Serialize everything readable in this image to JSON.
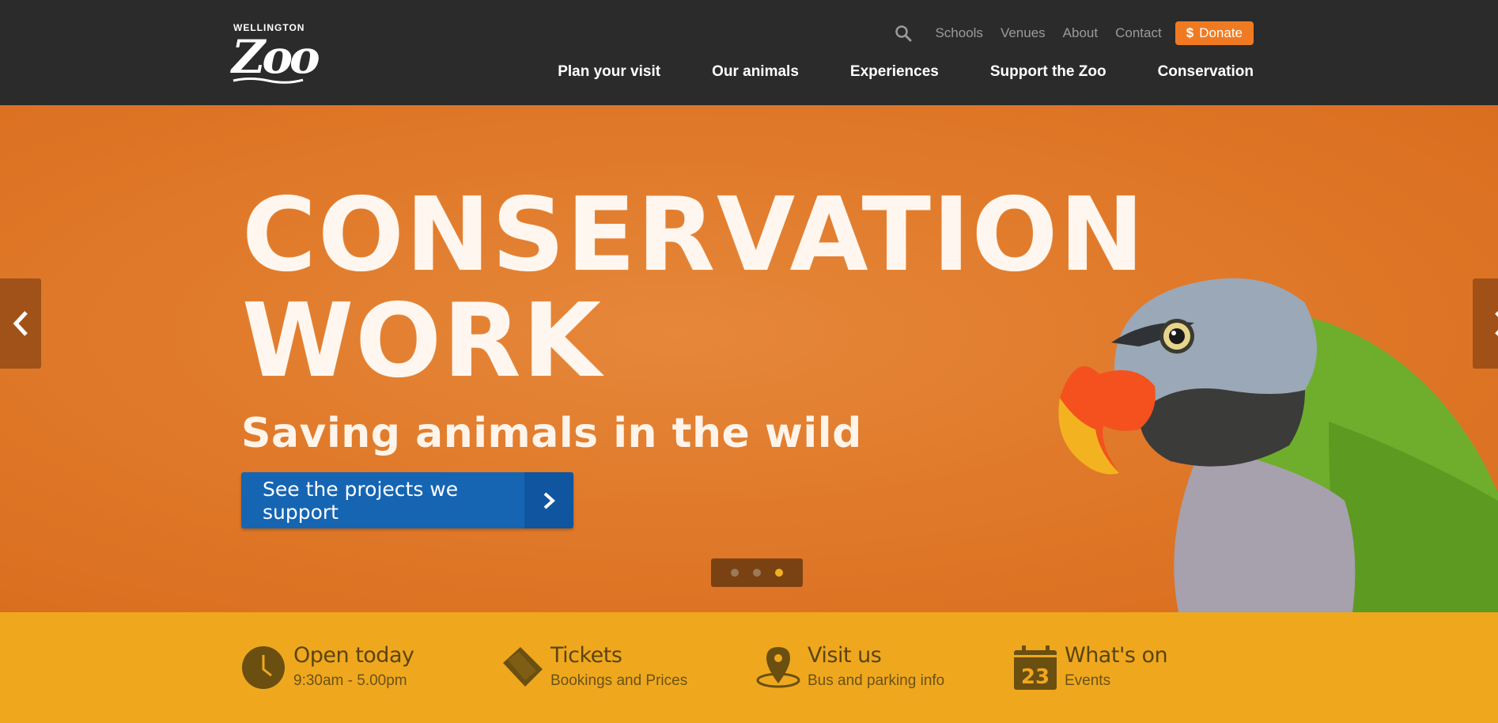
{
  "header": {
    "logo": {
      "top_text": "WELLINGTON",
      "main_text": "Zoo"
    },
    "utility_links": [
      "Schools",
      "Venues",
      "About",
      "Contact"
    ],
    "donate": {
      "label": "Donate",
      "icon": "dollar-icon",
      "color": "#f07a22"
    },
    "search_icon": "search-icon",
    "nav": [
      "Plan your visit",
      "Our animals",
      "Experiences",
      "Support the Zoo",
      "Conservation"
    ],
    "background": "#2b2b2b"
  },
  "hero": {
    "title_line1": "CONSERVATION",
    "title_line2": "WORK",
    "subtitle": "Saving animals in the wild",
    "cta_label": "See the projects we support",
    "background": "#e07a2a",
    "slides_count": 3,
    "active_slide": 3
  },
  "infobar": {
    "background": "#efa81e",
    "items": [
      {
        "title": "Open today",
        "sub": "9:30am - 5.00pm",
        "icon": "clock-icon"
      },
      {
        "title": "Tickets",
        "sub": "Bookings and Prices",
        "icon": "ticket-icon"
      },
      {
        "title": "Visit us",
        "sub": "Bus and parking info",
        "icon": "map-pin-icon"
      },
      {
        "title": "What's on",
        "sub": "Events",
        "icon": "calendar-icon",
        "calendar_day": "23"
      }
    ]
  }
}
